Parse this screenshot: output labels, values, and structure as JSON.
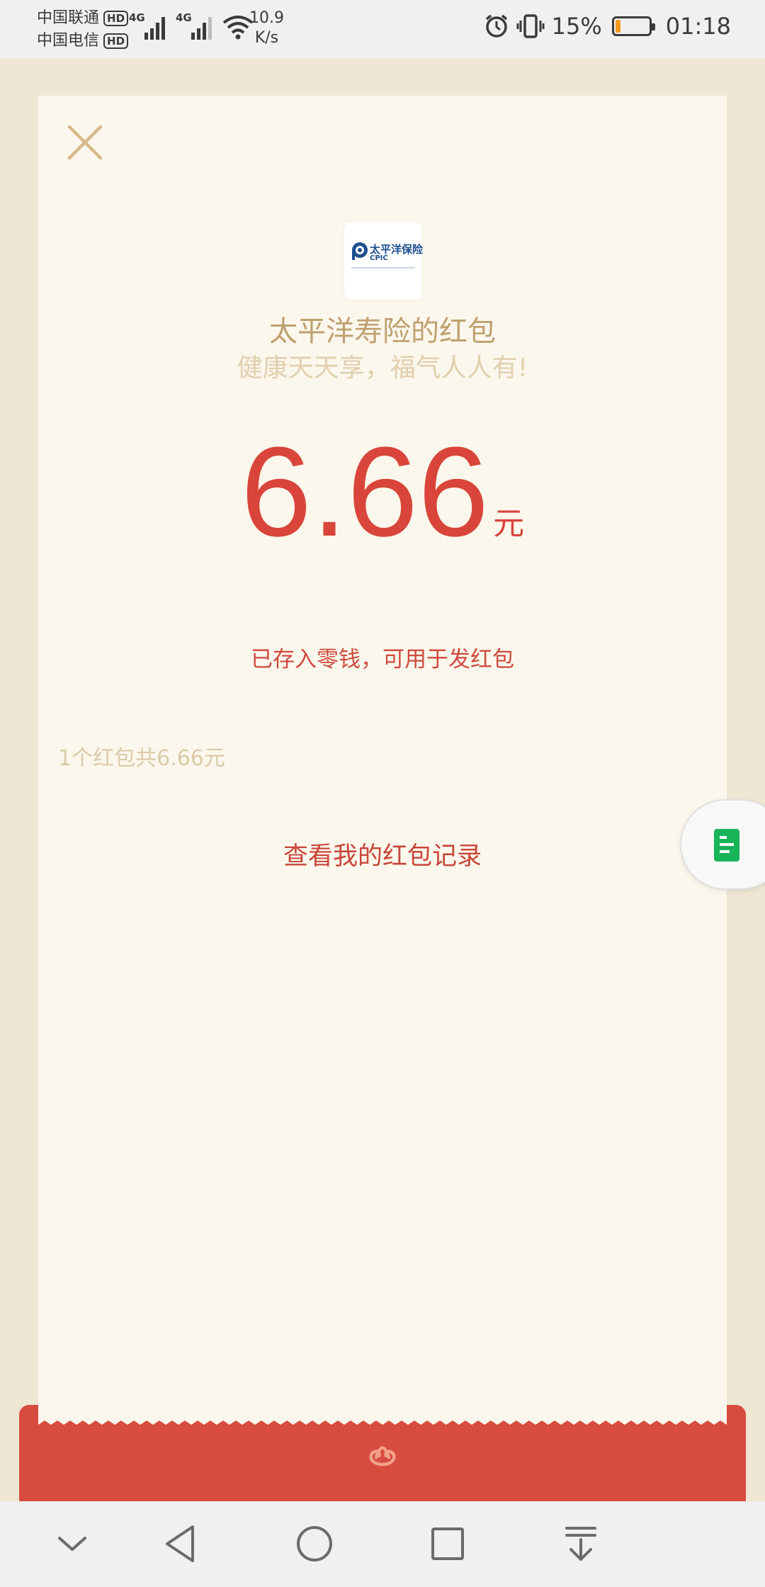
{
  "status_bar": {
    "carrier1": "中国联通",
    "carrier2": "中国电信",
    "hd_badge": "HD",
    "net_type": "4G",
    "net_speed_value": "10.9",
    "net_speed_unit": "K/s",
    "battery_percent": "15%",
    "battery_level": 0.15,
    "time": "01:18",
    "icons": [
      "alarm-icon",
      "vibrate-icon",
      "battery-icon",
      "wifi-icon",
      "signal-icon"
    ]
  },
  "card": {
    "logo_text": "太平洋保险",
    "logo_sub": "CPIC",
    "sender": "太平洋寿险的红包",
    "blessing": "健康天天享，福气人人有!",
    "amount": "6.66",
    "unit": "元",
    "stored_note": "已存入零钱，可用于发红包",
    "summary": "1个红包共6.66元",
    "records_link": "查看我的红包记录"
  },
  "colors": {
    "background": "#efe7d3",
    "card": "#fbf7ec",
    "accent_red": "#d9453a",
    "gold": "#bfa06f",
    "envelope": "#d84c3f",
    "float_icon": "#19b35a"
  },
  "nav_bar": {
    "icons": [
      "chevron-down-icon",
      "back-icon",
      "home-icon",
      "recents-icon",
      "notification-pull-icon"
    ]
  }
}
